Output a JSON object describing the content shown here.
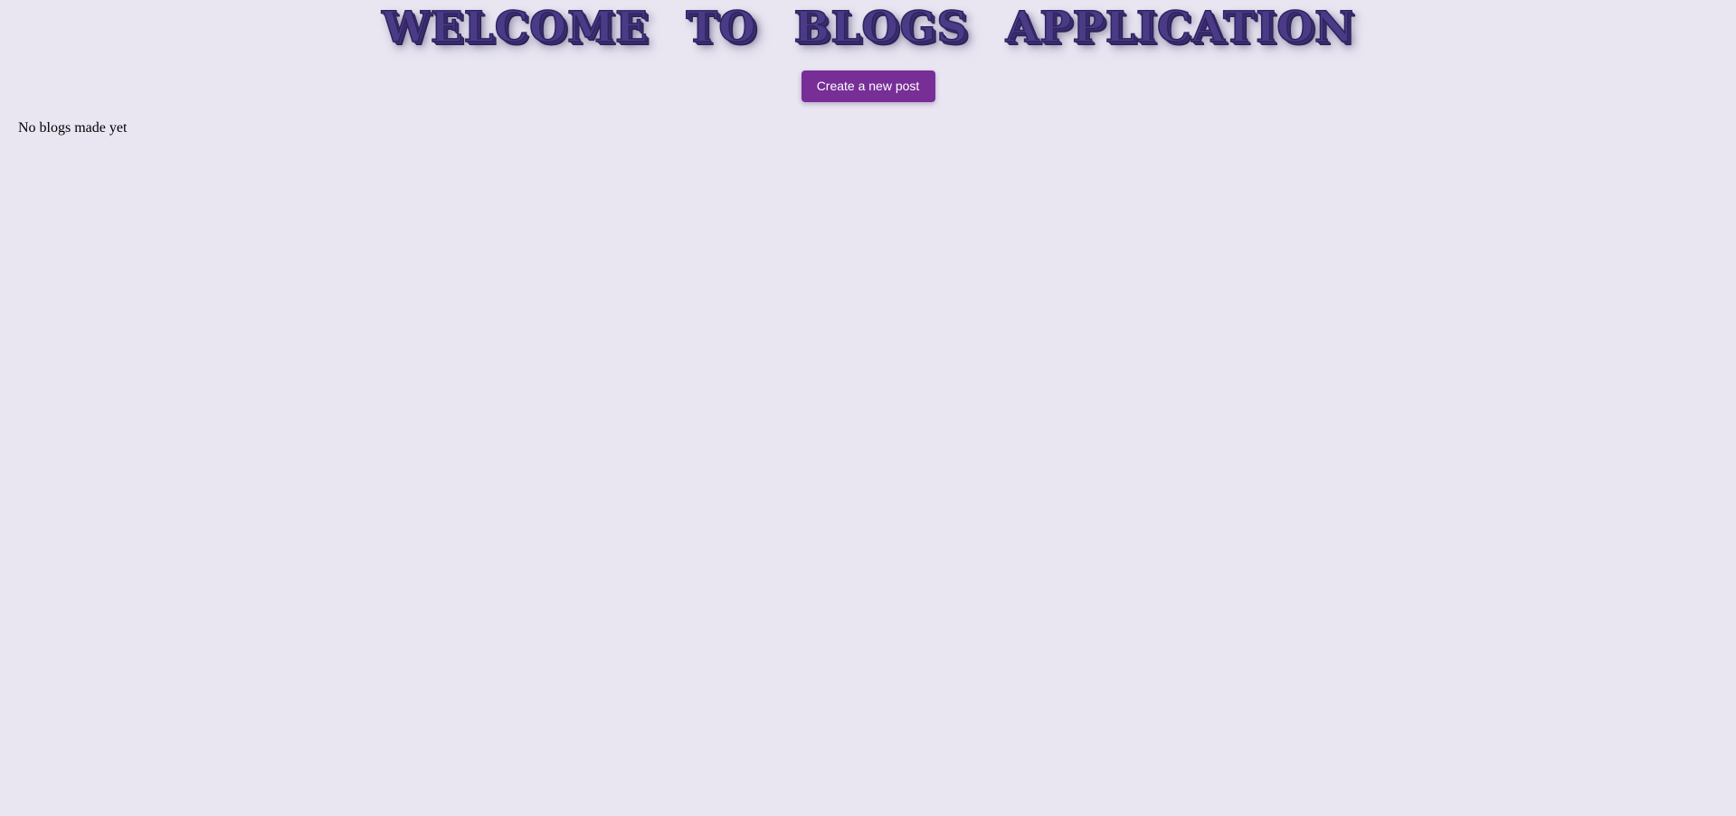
{
  "header": {
    "title": "WELCOME TO BLOGS APPLICATION"
  },
  "actions": {
    "create_post_label": "Create a new post"
  },
  "blogs": {
    "empty_message": "No blogs made yet"
  },
  "colors": {
    "background": "#e9e6f2",
    "title": "#4b3a86",
    "button": "#772e96",
    "button_text": "#ffffff"
  }
}
